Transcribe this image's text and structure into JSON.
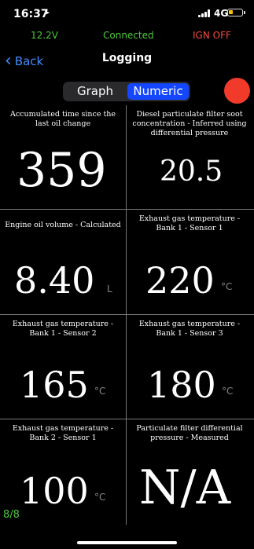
{
  "status_bar": {
    "time": "16:37",
    "location_icon": "location-arrow-icon",
    "network": "4G",
    "battery_color": "#f5c400"
  },
  "info_bar": {
    "voltage": "12.2V",
    "connection": "Connected",
    "ignition": "IGN OFF",
    "ok_color": "#4ec83a",
    "alert_color": "#f24b3b"
  },
  "nav": {
    "back_label": "Back",
    "title": "Logging"
  },
  "segment": {
    "graph_label": "Graph",
    "numeric_label": "Numeric",
    "selected": "Numeric",
    "accent": "#1446ff"
  },
  "record_button_color": "#f23a2b",
  "readings": [
    {
      "label": "Accumulated time since the last oil change",
      "value": "359",
      "unit": ""
    },
    {
      "label": "Diesel particulate filter soot concentration  -  Inferred using differential pressure",
      "value": "20.5",
      "unit": ""
    },
    {
      "label": "Engine oil volume  -  Calculated",
      "value": "8.40",
      "unit": "L"
    },
    {
      "label": "Exhaust gas temperature  -  Bank 1  -  Sensor 1",
      "value": "220",
      "unit": "°C"
    },
    {
      "label": "Exhaust gas temperature  -  Bank 1  -  Sensor 2",
      "value": "165",
      "unit": "°C"
    },
    {
      "label": "Exhaust gas temperature  -  Bank 1  -  Sensor 3",
      "value": "180",
      "unit": "°C"
    },
    {
      "label": "Exhaust gas temperature  -  Bank 2  -  Sensor 1",
      "value": "100",
      "unit": "°C"
    },
    {
      "label": "Particulate filter differential pressure  -  Measured",
      "value": "N/A",
      "unit": ""
    }
  ],
  "page_indicator": "8/8"
}
